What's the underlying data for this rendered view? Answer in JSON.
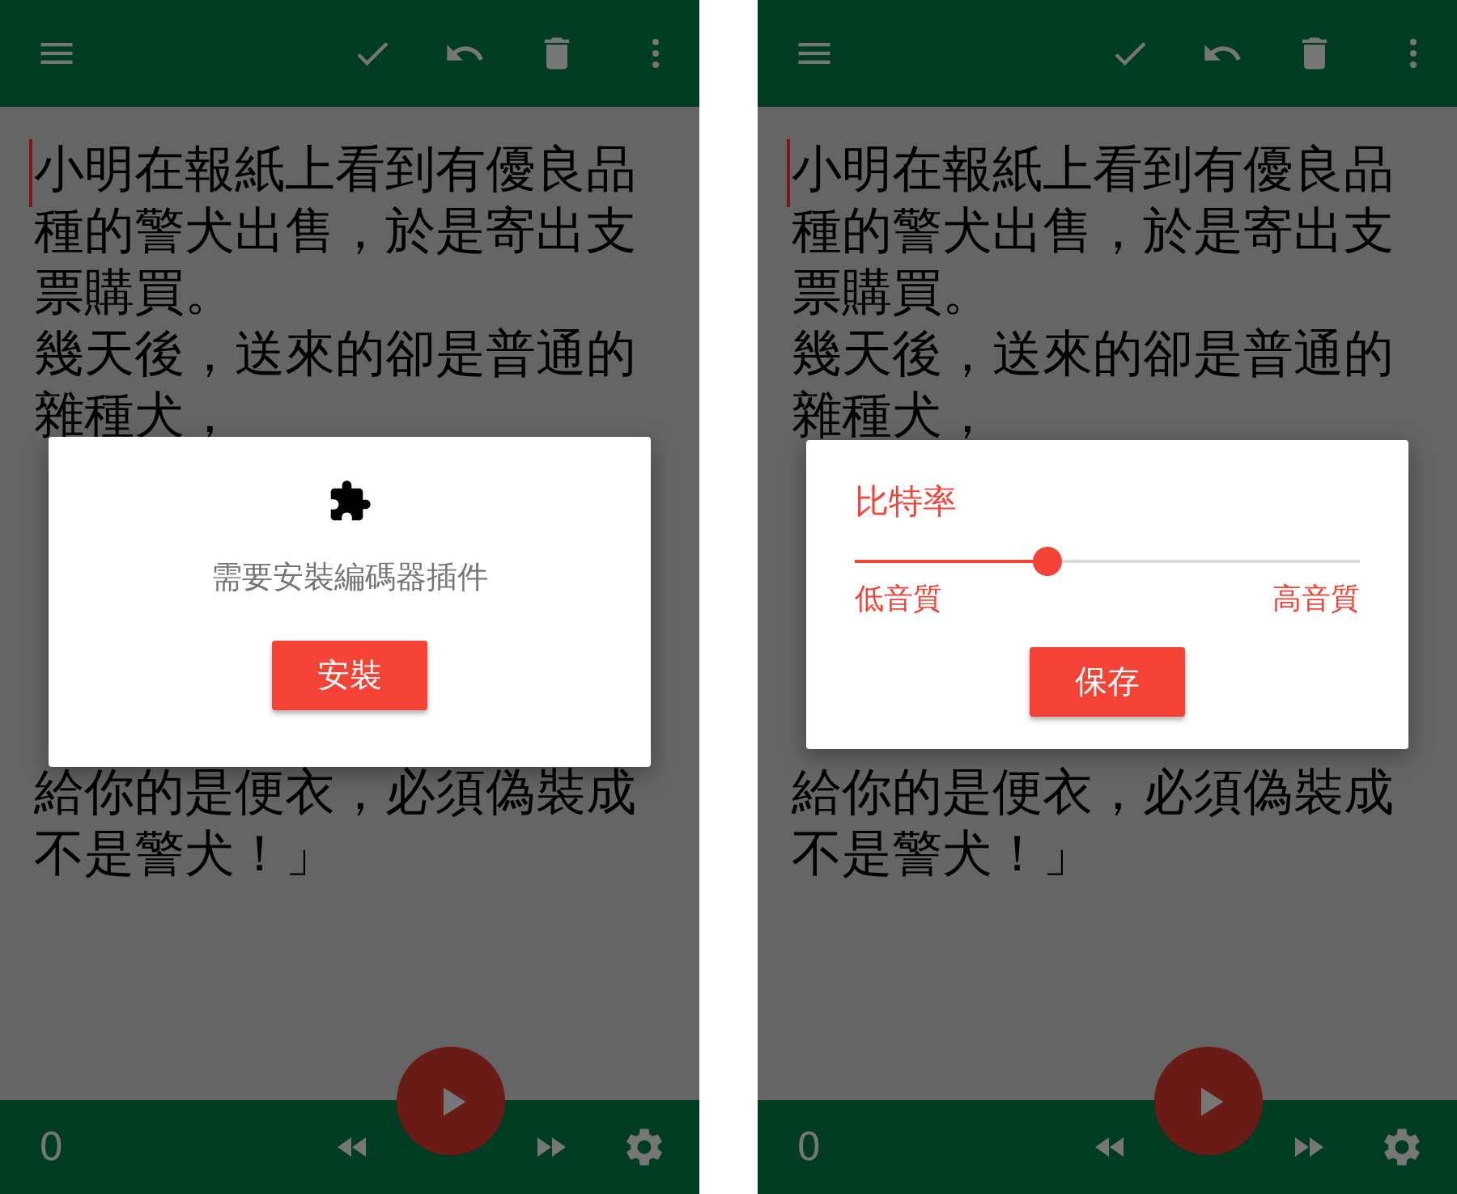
{
  "screens": [
    {
      "lines_before": [
        "小明在報紙上看到有優良品",
        "種的警犬出售，於是寄出支",
        "票購買。",
        "幾天後，送來的卻是普通的",
        "雜種犬，"
      ],
      "lines_after": [
        "給你的是便衣，必須偽裝成",
        "不是警犬！」"
      ],
      "counter": "0",
      "dialog": {
        "kind": "plugin_prompt",
        "message": "需要安裝編碼器插件",
        "button": "安裝"
      }
    },
    {
      "lines_before": [
        "小明在報紙上看到有優良品",
        "種的警犬出售，於是寄出支",
        "票購買。",
        "幾天後，送來的卻是普通的",
        "雜種犬，"
      ],
      "lines_after": [
        "給你的是便衣，必須偽裝成",
        "不是警犬！」"
      ],
      "counter": "0",
      "dialog": {
        "kind": "bitrate",
        "title": "比特率",
        "level": 0.38,
        "min_label": "低音質",
        "max_label": "高音質",
        "button": "保存"
      }
    }
  ]
}
